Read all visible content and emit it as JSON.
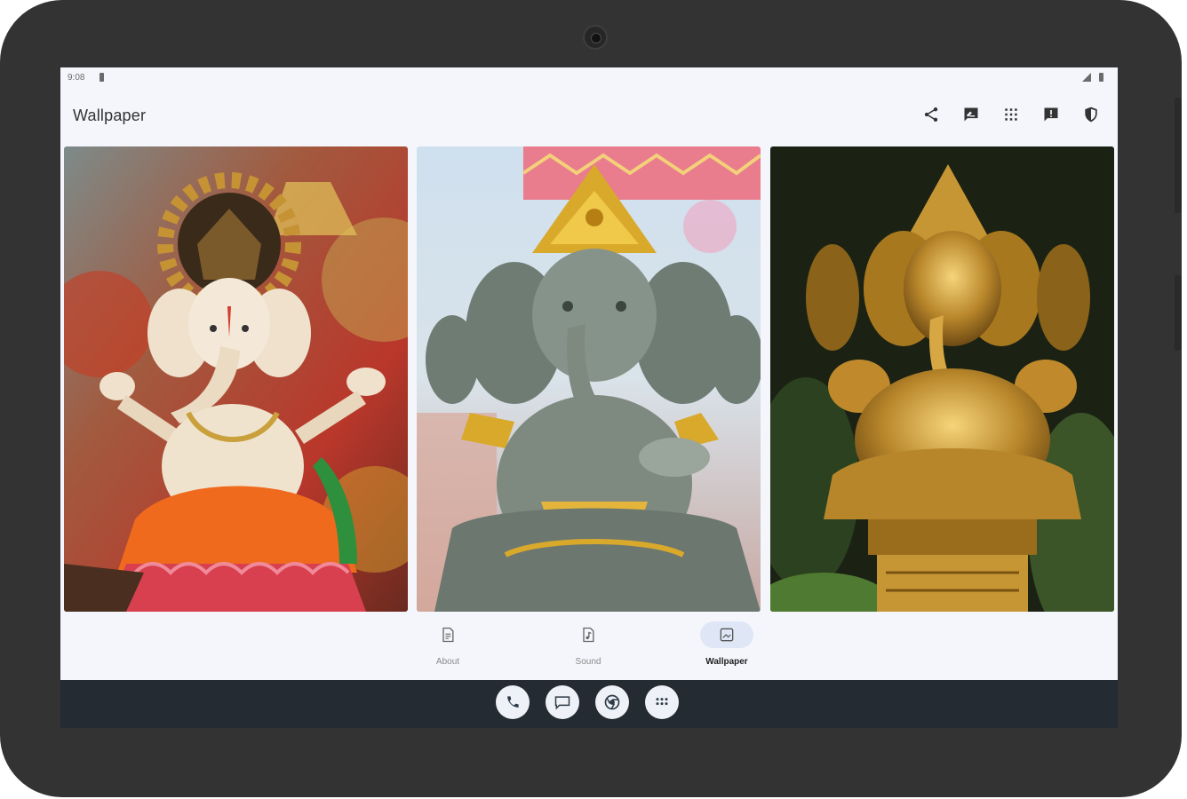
{
  "status_bar": {
    "time": "9:08"
  },
  "app_bar": {
    "title": "Wallpaper",
    "actions": [
      {
        "name": "share-icon"
      },
      {
        "name": "rate-review-icon"
      },
      {
        "name": "apps-grid-icon"
      },
      {
        "name": "feedback-icon"
      },
      {
        "name": "privacy-shield-icon"
      }
    ]
  },
  "wallpapers": [
    {
      "name": "ganesha-white-idol",
      "dominant_colors": [
        "#e9dcc7",
        "#ef6a1c",
        "#c99b3a",
        "#d9404f"
      ]
    },
    {
      "name": "ganesha-stone-idol",
      "dominant_colors": [
        "#7e8a80",
        "#d9a92b",
        "#e9b3cc",
        "#c9dbe9"
      ]
    },
    {
      "name": "ganesha-golden-idol",
      "dominant_colors": [
        "#b8862a",
        "#f3c86a",
        "#1f2a17",
        "#3f5a2a"
      ]
    }
  ],
  "bottom_nav": {
    "items": [
      {
        "label": "About",
        "icon": "document-icon",
        "active": false
      },
      {
        "label": "Sound",
        "icon": "music-file-icon",
        "active": false
      },
      {
        "label": "Wallpaper",
        "icon": "wallpaper-icon",
        "active": true
      }
    ]
  },
  "dock": [
    "phone-icon",
    "messages-icon",
    "chrome-icon",
    "app-drawer-icon"
  ],
  "colors": {
    "bezel": "#333333",
    "screen_bg": "#f4f6fb",
    "active_pill": "#dfe6f6",
    "taskbar": "#242b33"
  }
}
